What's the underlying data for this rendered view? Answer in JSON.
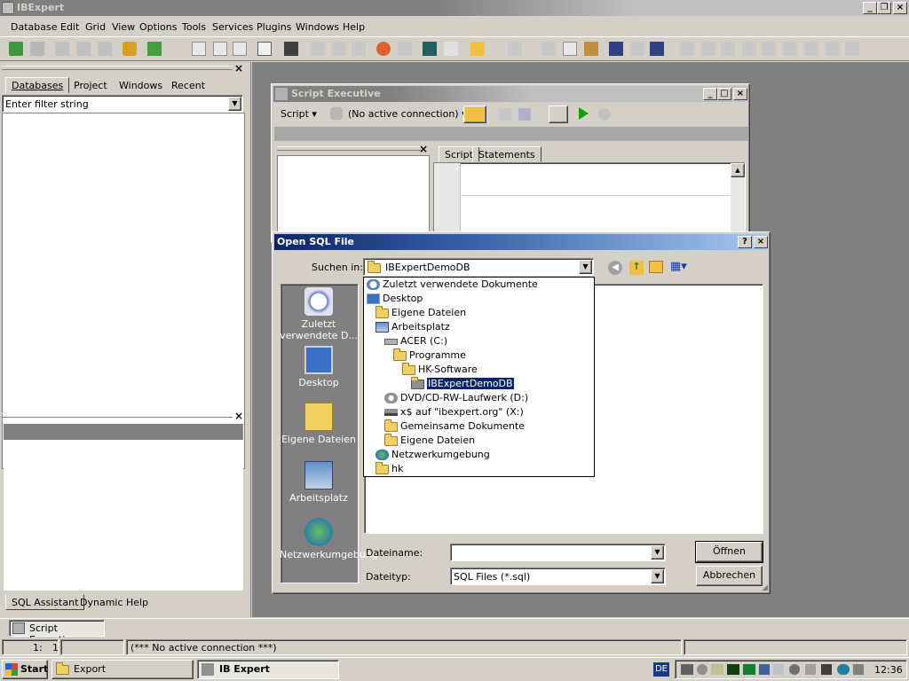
{
  "app": {
    "title": "IBExpert"
  },
  "menu": [
    "Database",
    "Edit",
    "Grid",
    "View",
    "Options",
    "Tools",
    "Services",
    "Plugins",
    "Windows",
    "Help"
  ],
  "left_panel": {
    "tabs": [
      "Databases",
      "Project",
      "Windows",
      "Recent"
    ],
    "filter_placeholder": "Enter filter string",
    "bottom_tabs": [
      "SQL Assistant",
      "Dynamic Help"
    ]
  },
  "script_exec": {
    "title": "Script Executive",
    "script_btn": "Script",
    "connection": "(No active connection)",
    "tabs": [
      "Script",
      "Statements"
    ]
  },
  "dialog": {
    "title": "Open SQL File",
    "look_in_label": "Suchen in:",
    "look_in_value": "IBExpertDemoDB",
    "places": [
      "Zuletzt verwendete D...",
      "Desktop",
      "Eigene Dateien",
      "Arbeitsplatz",
      "Netzwerkumgebung"
    ],
    "dropdown": [
      {
        "label": "Zuletzt verwendete Dokumente",
        "icon": "recent-docs-icon",
        "indent": 0
      },
      {
        "label": "Desktop",
        "icon": "desktop-icon",
        "indent": 0
      },
      {
        "label": "Eigene Dateien",
        "icon": "folder-icon",
        "indent": 1
      },
      {
        "label": "Arbeitsplatz",
        "icon": "computer-icon",
        "indent": 1
      },
      {
        "label": "ACER (C:)",
        "icon": "drive-icon",
        "indent": 2
      },
      {
        "label": "Programme",
        "icon": "folder-icon",
        "indent": 3
      },
      {
        "label": "HK-Software",
        "icon": "folder-icon",
        "indent": 4
      },
      {
        "label": "IBExpertDemoDB",
        "icon": "folder-open-icon",
        "indent": 5,
        "selected": true
      },
      {
        "label": "DVD/CD-RW-Laufwerk (D:)",
        "icon": "cd-drive-icon",
        "indent": 2
      },
      {
        "label": "x$ auf \"ibexpert.org\" (X:)",
        "icon": "network-drive-icon",
        "indent": 2
      },
      {
        "label": "Gemeinsame Dokumente",
        "icon": "folder-icon",
        "indent": 2
      },
      {
        "label": "Eigene Dateien",
        "icon": "folder-icon",
        "indent": 2
      },
      {
        "label": "Netzwerkumgebung",
        "icon": "network-icon",
        "indent": 1
      },
      {
        "label": "hk",
        "icon": "folder-icon",
        "indent": 1
      }
    ],
    "filename_label": "Dateiname:",
    "filename_value": "",
    "filetype_label": "Dateityp:",
    "filetype_value": "SQL Files (*.sql)",
    "open_btn": "Öffnen",
    "cancel_btn": "Abbrechen"
  },
  "window_bar": {
    "item": "Script Executive"
  },
  "status": {
    "pos_line": "1:",
    "pos_col": "1",
    "message": "(*** No active connection ***)"
  },
  "taskbar": {
    "start": "Start",
    "items": [
      "Export",
      "IB Expert"
    ],
    "lang": "DE",
    "clock": "12:36"
  },
  "colors": {
    "title_active": "#0a246a",
    "title_gradient": "#a6caf0",
    "title_inactive": "#808080",
    "desktop_mdi": "#808080",
    "selection": "#0a246a"
  }
}
